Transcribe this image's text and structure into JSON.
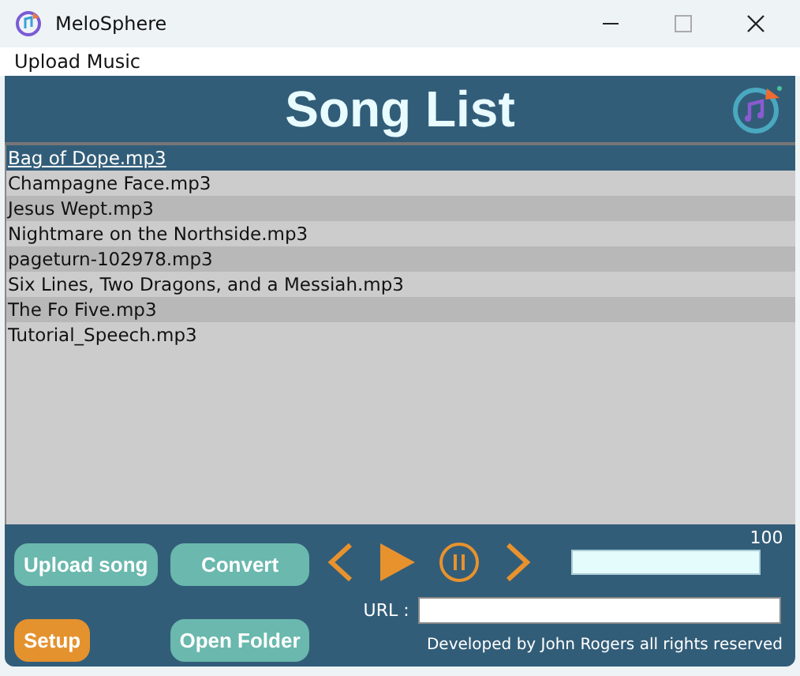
{
  "window": {
    "title": "MeloSphere"
  },
  "menu": [
    "Upload Music"
  ],
  "header": {
    "title": "Song List"
  },
  "songs": [
    {
      "name": "Bag of Dope.mp3",
      "selected": true
    },
    {
      "name": "Champagne Face.mp3",
      "selected": false
    },
    {
      "name": "Jesus Wept.mp3",
      "selected": false
    },
    {
      "name": "Nightmare on the Northside.mp3",
      "selected": false
    },
    {
      "name": "pageturn-102978.mp3",
      "selected": false
    },
    {
      "name": "Six Lines, Two Dragons, and a Messiah.mp3",
      "selected": false
    },
    {
      "name": "The Fo Five.mp3",
      "selected": false
    },
    {
      "name": "Tutorial_Speech.mp3",
      "selected": false
    }
  ],
  "buttons": [
    {
      "label": "Upload song",
      "kind": "teal"
    },
    {
      "label": "Convert",
      "kind": "teal"
    },
    {
      "label": "Setup",
      "kind": "orange"
    },
    {
      "label": "Open Folder",
      "kind": "teal"
    }
  ],
  "volume": {
    "reading": "100",
    "level": 1
  },
  "url": {
    "label": "URL :"
  },
  "footer": "Developed by John Rogers all rights reserved"
}
